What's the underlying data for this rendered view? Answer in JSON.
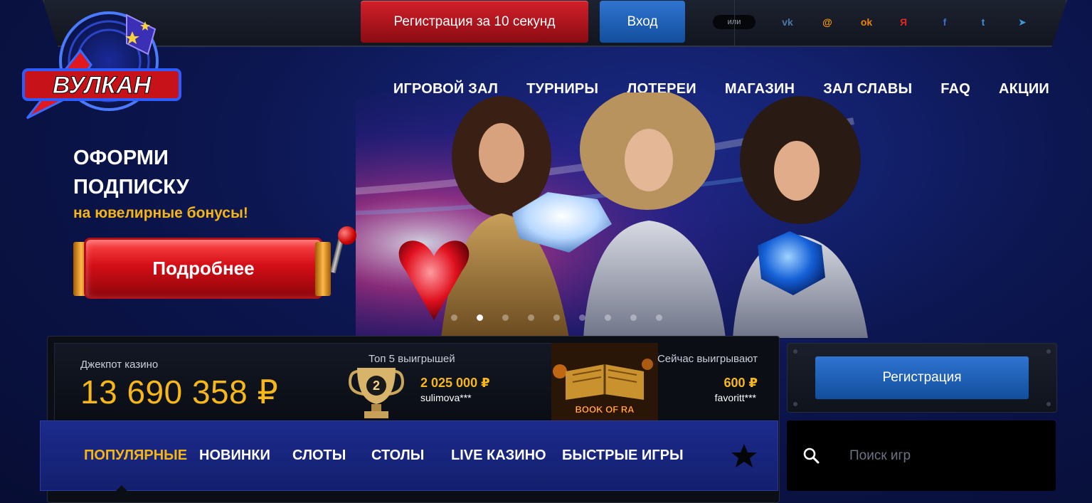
{
  "header": {
    "register_label": "Регистрация за 10 секунд",
    "login_label": "Вход",
    "or_label": "или",
    "socials": [
      {
        "name": "vk-icon",
        "glyph": "vk",
        "color": "#4a76a8"
      },
      {
        "name": "mail-icon",
        "glyph": "@",
        "color": "#f59b00"
      },
      {
        "name": "odnoklassniki-icon",
        "glyph": "ok",
        "color": "#ee8208"
      },
      {
        "name": "yandex-icon",
        "glyph": "Я",
        "color": "#e52620"
      },
      {
        "name": "facebook-icon",
        "glyph": "f",
        "color": "#3b6cd1"
      },
      {
        "name": "twitter-icon",
        "glyph": "t",
        "color": "#3b8fd8"
      },
      {
        "name": "telegram-icon",
        "glyph": "➤",
        "color": "#3a9bd9"
      }
    ]
  },
  "logo": {
    "text": "ВУЛКАН"
  },
  "nav": {
    "items": [
      "ИГРОВОЙ ЗАЛ",
      "ТУРНИРЫ",
      "ЛОТЕРЕИ",
      "МАГАЗИН",
      "ЗАЛ СЛАВЫ",
      "FAQ",
      "АКЦИИ"
    ]
  },
  "hero": {
    "title_line1": "ОФОРМИ",
    "title_line2": "ПОДПИСКУ",
    "subtitle": "на ювелирные бонусы!",
    "button_label": "Подробнее",
    "slides_count": 9,
    "active_slide": 2
  },
  "jackpot": {
    "label": "Джекпот казино",
    "value": "13 690 358 ₽"
  },
  "top5": {
    "label": "Топ 5 выигрышей",
    "place": "2",
    "amount": "2 025 000 ₽",
    "user": "sulimova***"
  },
  "now_winning": {
    "label": "Сейчас выигрывают",
    "game": "BOOK OF RA",
    "amount": "600 ₽",
    "user": "favoritt***"
  },
  "tabs": {
    "items": [
      "ПОПУЛЯРНЫЕ",
      "НОВИНКИ",
      "СЛОТЫ",
      "СТОЛЫ",
      "LIVE КАЗИНО",
      "БЫСТРЫЕ ИГРЫ"
    ],
    "active": 0
  },
  "sidebar": {
    "register_label": "Регистрация",
    "search_placeholder": "Поиск игр"
  },
  "colors": {
    "accent_gold": "#f5b514",
    "register_red": "#d31f2a",
    "login_blue": "#2f74d1",
    "background": "#0c1650"
  }
}
